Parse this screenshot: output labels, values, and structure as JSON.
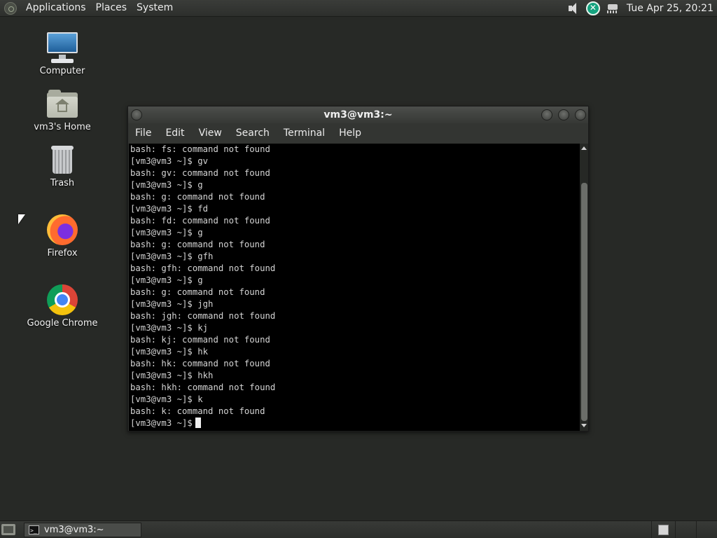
{
  "top_panel": {
    "menus": [
      "Applications",
      "Places",
      "System"
    ],
    "clock": "Tue Apr 25, 20:21",
    "tray_icons": [
      "volume-icon",
      "update-notifier-icon",
      "network-icon"
    ]
  },
  "desktop": {
    "icons": [
      {
        "label": "Computer",
        "icon": "computer-icon"
      },
      {
        "label": "vm3's Home",
        "icon": "home-folder-icon"
      },
      {
        "label": "Trash",
        "icon": "trash-icon"
      },
      {
        "label": "Firefox",
        "icon": "firefox-icon"
      },
      {
        "label": "Google Chrome",
        "icon": "chrome-icon"
      }
    ]
  },
  "terminal": {
    "title": "vm3@vm3:~",
    "menus": [
      "File",
      "Edit",
      "View",
      "Search",
      "Terminal",
      "Help"
    ],
    "lines": [
      "bash: fs: command not found",
      "[vm3@vm3 ~]$ gv",
      "bash: gv: command not found",
      "[vm3@vm3 ~]$ g",
      "bash: g: command not found",
      "[vm3@vm3 ~]$ fd",
      "bash: fd: command not found",
      "[vm3@vm3 ~]$ g",
      "bash: g: command not found",
      "[vm3@vm3 ~]$ gfh",
      "bash: gfh: command not found",
      "[vm3@vm3 ~]$ g",
      "bash: g: command not found",
      "[vm3@vm3 ~]$ jgh",
      "bash: jgh: command not found",
      "[vm3@vm3 ~]$ kj",
      "bash: kj: command not found",
      "[vm3@vm3 ~]$ hk",
      "bash: hk: command not found",
      "[vm3@vm3 ~]$ hkh",
      "bash: hkh: command not found",
      "[vm3@vm3 ~]$ k",
      "bash: k: command not found"
    ],
    "prompt": "[vm3@vm3 ~]$"
  },
  "taskbar": {
    "window_button_label": "vm3@vm3:~"
  },
  "colors": {
    "desktop_bg": "#272926",
    "panel_bg": "#333532",
    "terminal_bg": "#000000",
    "terminal_fg": "#d4d4d4"
  }
}
